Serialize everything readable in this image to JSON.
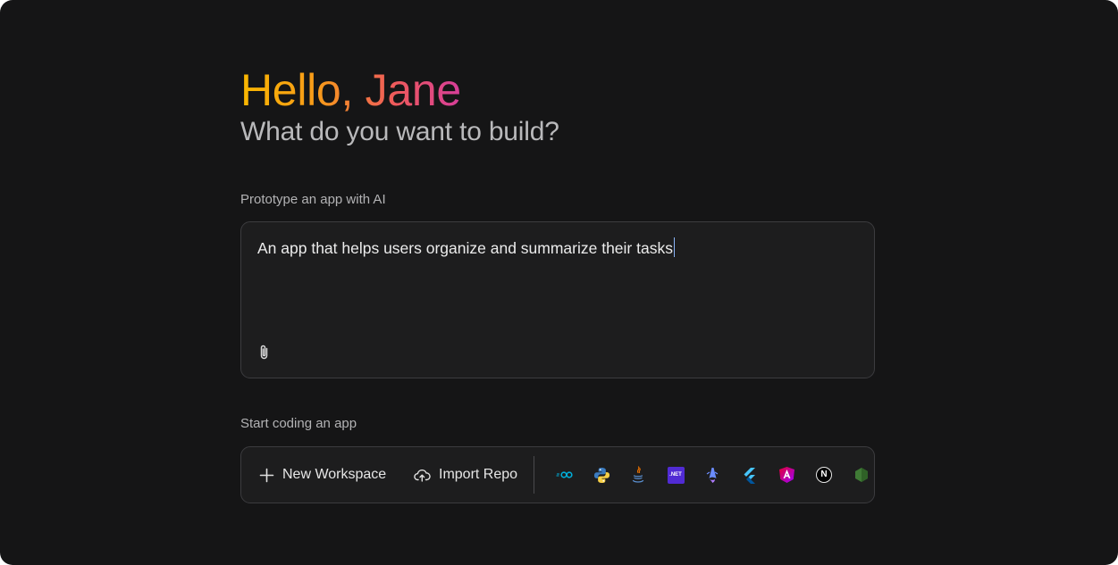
{
  "hero": {
    "greeting": "Hello, Jane",
    "subtitle": "What do you want to build?"
  },
  "prototype": {
    "label": "Prototype an app with AI",
    "prompt_value": "An app that helps users organize and summarize their tasks",
    "attach_icon": "paperclip-icon"
  },
  "coding": {
    "label": "Start coding an app",
    "new_workspace_label": "New Workspace",
    "import_repo_label": "Import Repo",
    "templates": [
      {
        "name": "go-icon",
        "color": "#00add8"
      },
      {
        "name": "python-icon",
        "color": "#3776ab"
      },
      {
        "name": "java-icon",
        "color": "#e76f00"
      },
      {
        "name": "dotnet-icon",
        "color": "#512bd4"
      },
      {
        "name": "astro-icon",
        "color": "#6b8cff"
      },
      {
        "name": "flutter-icon",
        "color": "#47c5fb"
      },
      {
        "name": "angular-icon",
        "color": "#dd0031"
      },
      {
        "name": "nextjs-icon",
        "color": "#000000"
      },
      {
        "name": "nodejs-icon",
        "color": "#4a7f3a"
      }
    ],
    "dotnet_text": ".NET",
    "go_text": "GO",
    "nextjs_text": "N"
  },
  "colors": {
    "background": "#151516",
    "card": "#1d1d1e",
    "border": "#3c3c3f",
    "greeting_gradient": [
      "#f9b700",
      "#ee5a5c",
      "#d63d9a"
    ],
    "caret": "#8ab4f8"
  }
}
